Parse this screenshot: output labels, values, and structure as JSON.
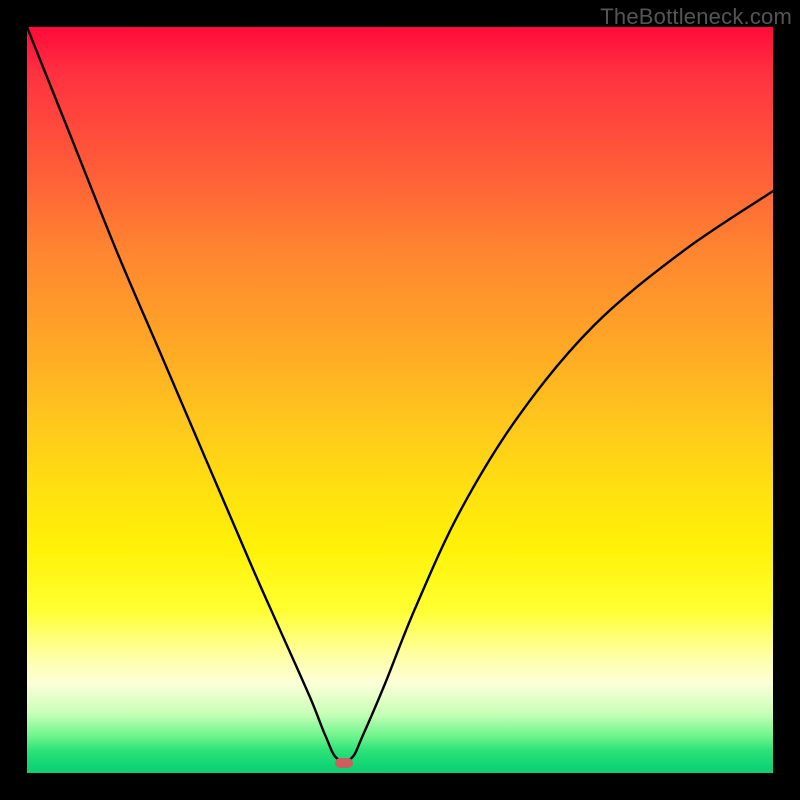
{
  "watermark": "TheBottleneck.com",
  "chart_data": {
    "type": "line",
    "title": "",
    "xlabel": "",
    "ylabel": "",
    "xlim": [
      0,
      100
    ],
    "ylim": [
      0,
      100
    ],
    "grid": false,
    "legend": false,
    "series": [
      {
        "name": "curve",
        "x": [
          0,
          6,
          12,
          18,
          24,
          30,
          34,
          38,
          40,
          41.5,
          43.5,
          45,
          48,
          52,
          58,
          66,
          76,
          88,
          100
        ],
        "y": [
          100,
          85,
          70,
          56,
          42,
          28,
          19,
          10,
          5,
          2,
          2,
          5,
          12,
          22,
          35,
          48,
          60,
          70,
          78
        ]
      }
    ],
    "marker": {
      "x": 42.5,
      "y": 1.4
    },
    "colors": {
      "curve": "#000000",
      "marker": "#c9605b",
      "gradient_top": "#ff0a3a",
      "gradient_bottom": "#10d072"
    }
  }
}
